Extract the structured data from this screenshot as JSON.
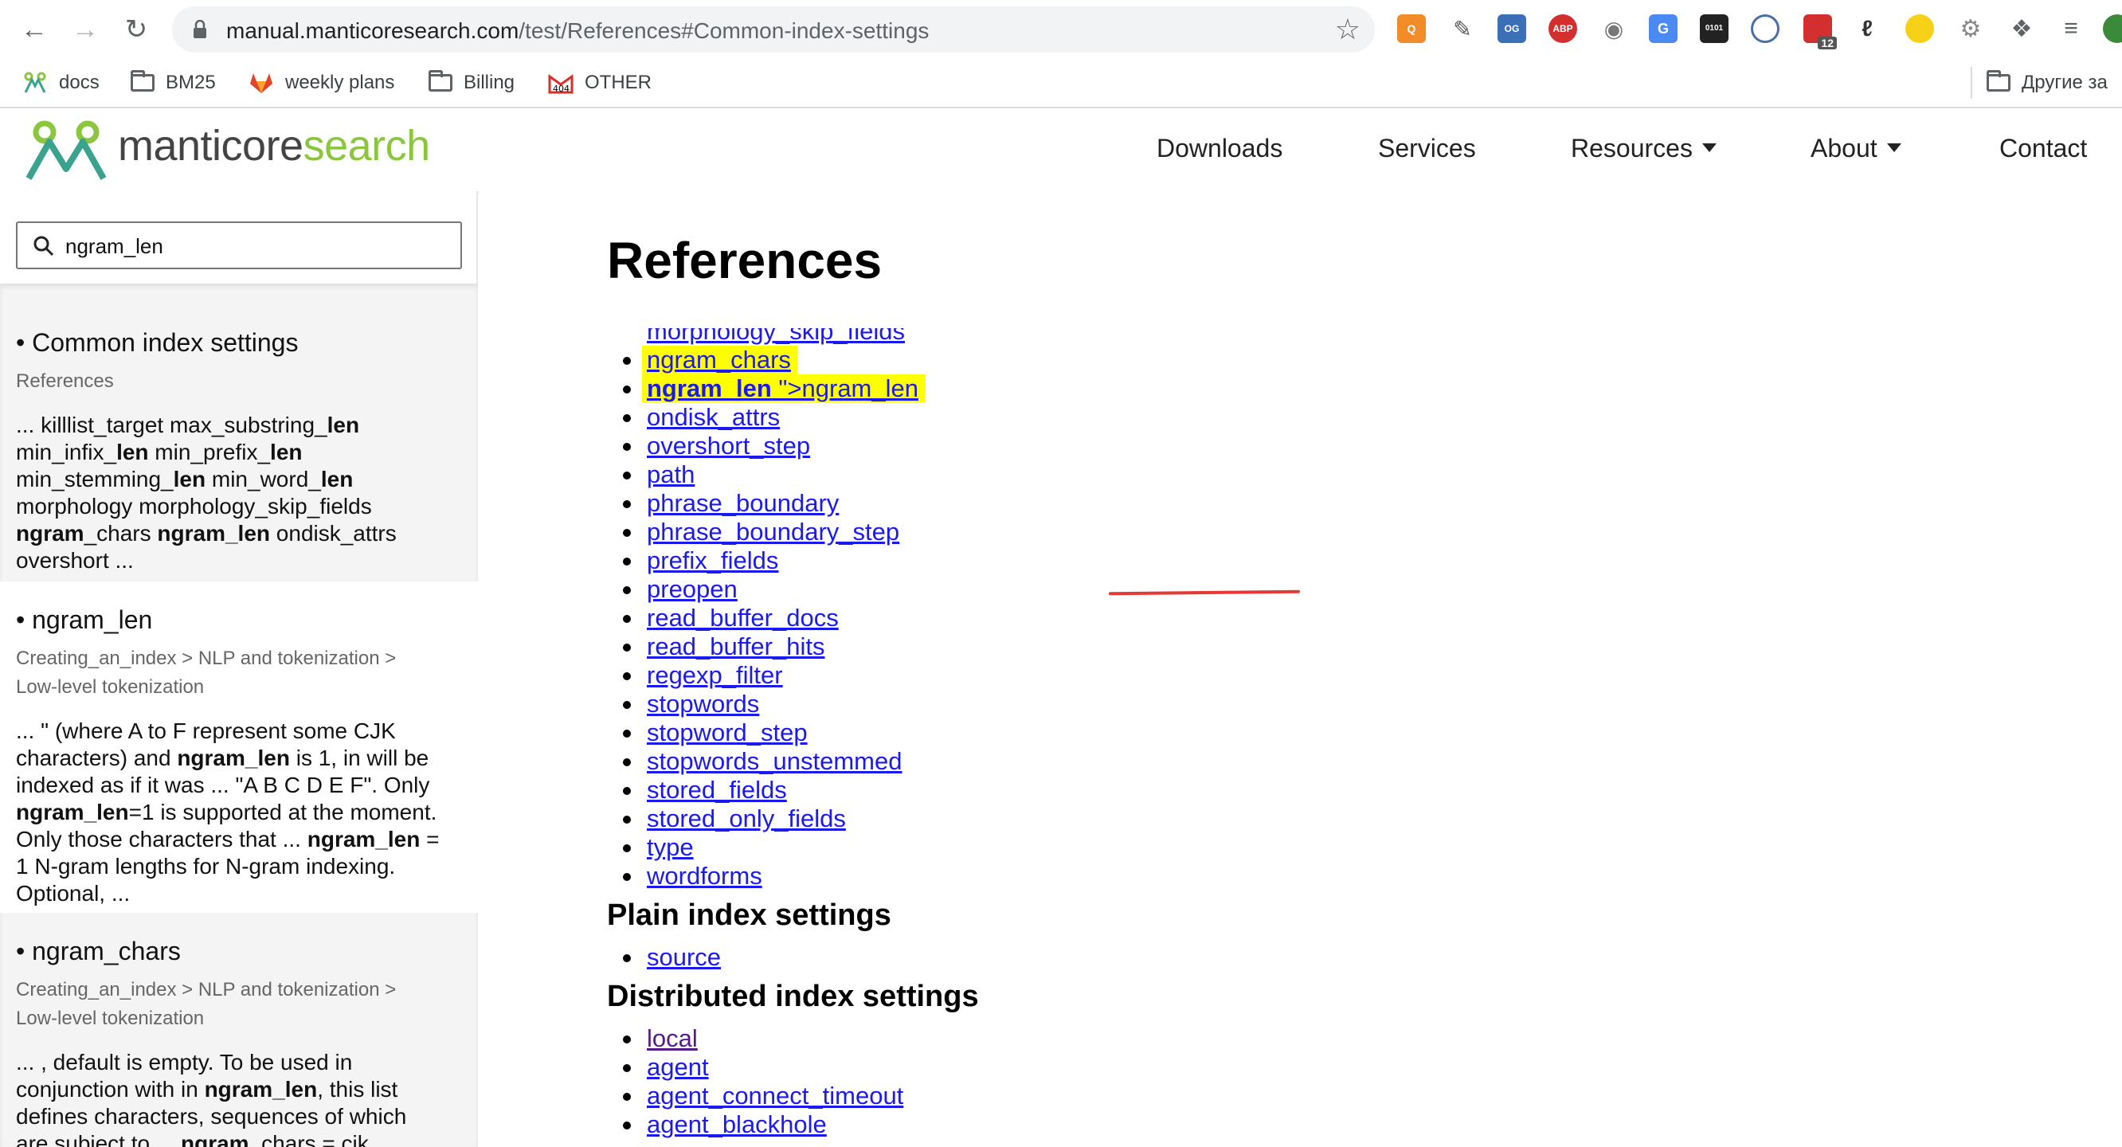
{
  "browser": {
    "url_main": "manual.manticoresearch.com",
    "url_path": "/test/References#Common-index-settings",
    "extensions": [
      "Q",
      "OG",
      "ABP",
      "0101",
      "12"
    ],
    "bookmarks": [
      {
        "label": "docs"
      },
      {
        "label": "BM25"
      },
      {
        "label": "weekly plans"
      },
      {
        "label": "Billing"
      },
      {
        "label": "OTHER"
      }
    ],
    "other_bookmarks": "Другие за"
  },
  "site": {
    "brand_part1": "manticore",
    "brand_part2": "search",
    "nav": [
      "Downloads",
      "Services",
      "Resources",
      "About",
      "Contact"
    ]
  },
  "sidebar": {
    "search_value": "ngram_len",
    "results": [
      {
        "title": "• Common index settings",
        "crumb": "References"
      },
      {
        "title": "• ngram_len",
        "crumb_1": "Creating_an_index > NLP and tokenization >",
        "crumb_2": "Low-level tokenization"
      },
      {
        "title": "• ngram_chars",
        "crumb_1": "Creating_an_index > NLP and tokenization >",
        "crumb_2": "Low-level tokenization"
      }
    ]
  },
  "main": {
    "title": "References",
    "common_links": [
      "morphology_skip_fields",
      "ngram_chars",
      "ngram_len",
      "ondisk_attrs",
      "overshort_step",
      "path",
      "phrase_boundary",
      "phrase_boundary_step",
      "prefix_fields",
      "preopen",
      "read_buffer_docs",
      "read_buffer_hits",
      "regexp_filter",
      "stopwords",
      "stopword_step",
      "stopwords_unstemmed",
      "stored_fields",
      "stored_only_fields",
      "type",
      "wordforms"
    ],
    "ngram_len_suffix": " \">",
    "plain_heading": "Plain index settings",
    "plain_links": [
      "source"
    ],
    "distributed_heading": "Distributed index settings",
    "distributed_links": [
      "local",
      "agent",
      "agent_connect_timeout",
      "agent_blackhole"
    ]
  }
}
